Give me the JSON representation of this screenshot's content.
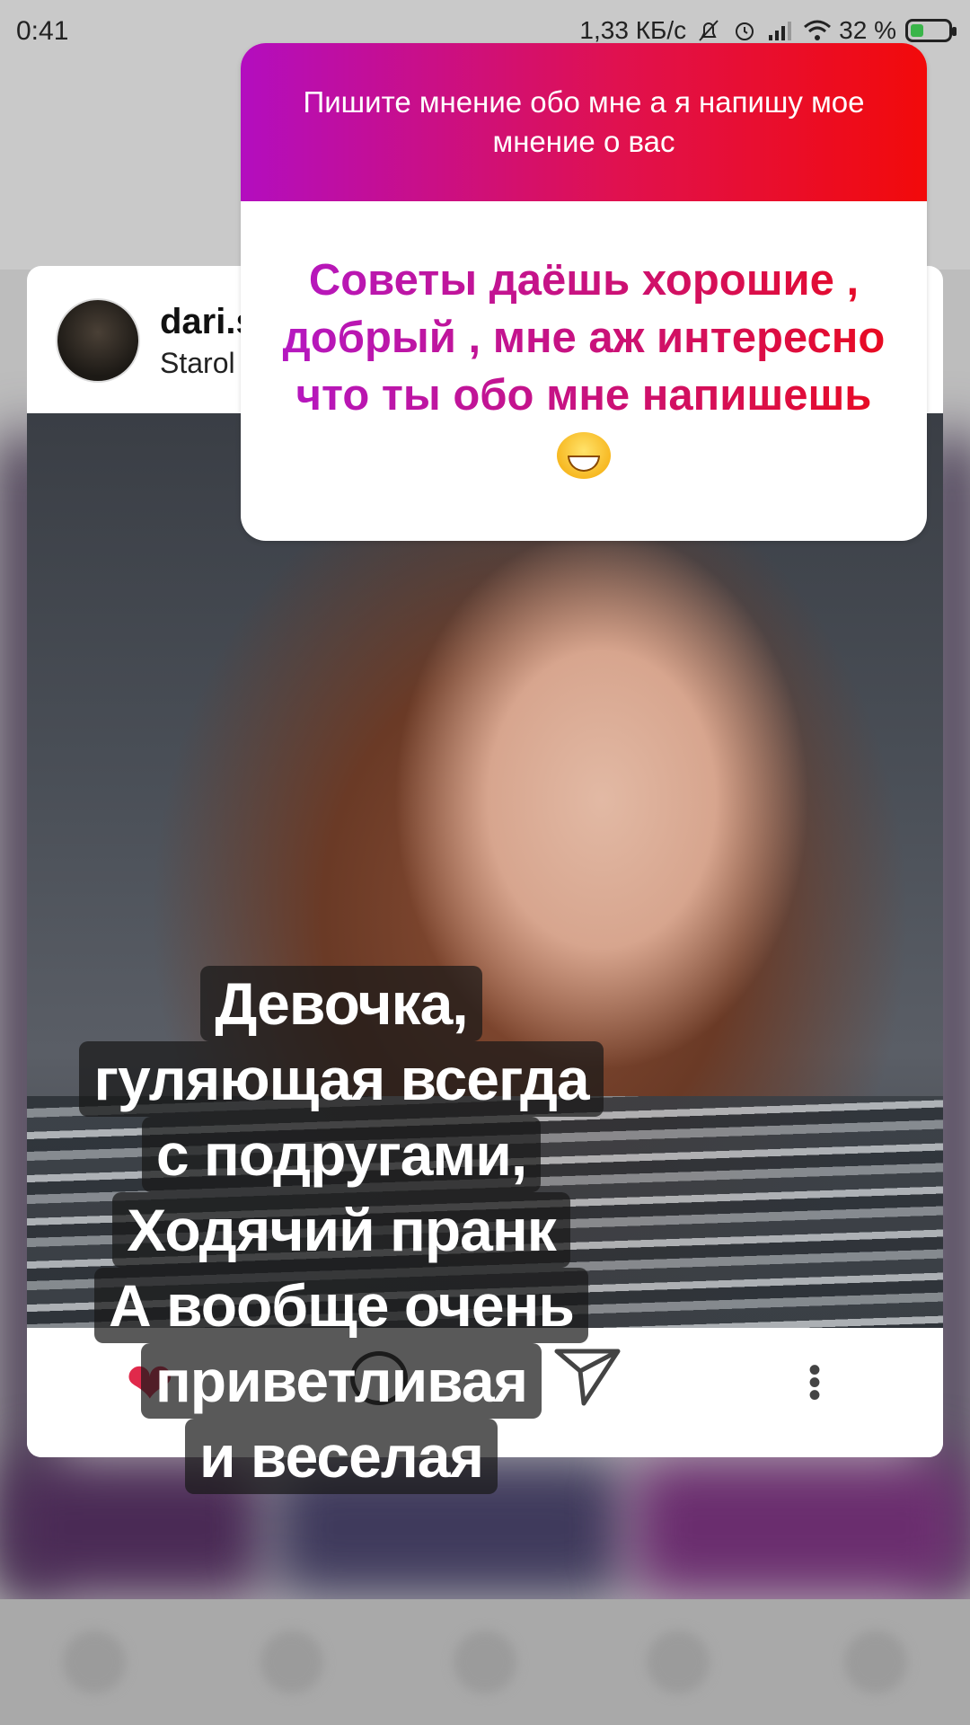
{
  "status_bar": {
    "time": "0:41",
    "network_speed": "1,33 КБ/с",
    "battery_percent": "32 %",
    "battery_level": 0.32
  },
  "post": {
    "username": "dari.s",
    "location": "Starol",
    "like_icon": "heart-icon",
    "comment_icon": "comment-icon",
    "share_icon": "send-icon",
    "more_icon": "more-icon"
  },
  "question_sticker": {
    "question": "Пишите мнение обо мне а я напишу мое мнение о вас",
    "answer": "Советы даёшь хорошие , добрый , мне аж интересно что ты обо мне напишешь",
    "emoji": "grinning-squinting-face",
    "gradient_start": "#b30dbf",
    "gradient_end": "#f20a0a"
  },
  "caption_lines": [
    "Девочка,",
    "гуляющая всегда",
    "с подругами,",
    "Ходячий пранк",
    "А вообще очень",
    "приветливая",
    "и веселая"
  ],
  "colors": {
    "like": "#e0294b"
  }
}
